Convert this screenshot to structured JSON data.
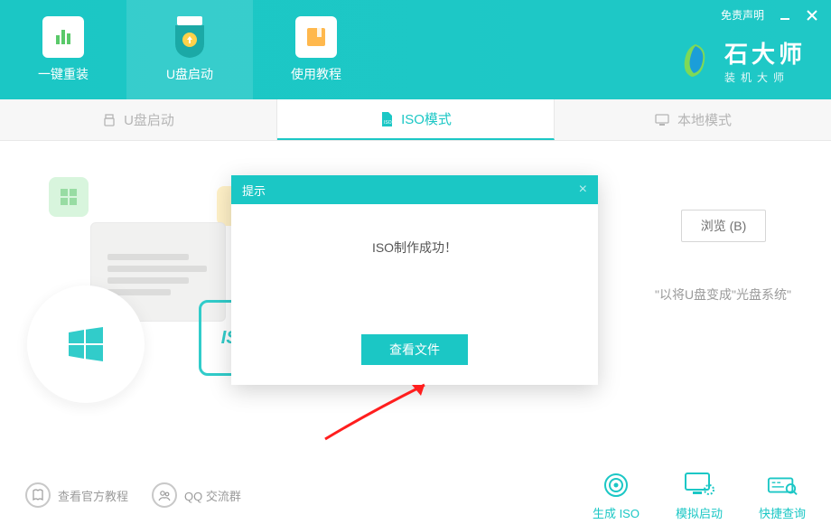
{
  "header": {
    "disclaimer": "免责声明",
    "nav": [
      {
        "label": "一键重装"
      },
      {
        "label": "U盘启动"
      },
      {
        "label": "使用教程"
      }
    ],
    "brand_name": "石大师",
    "brand_sub": "装机大师"
  },
  "tabs": [
    {
      "label": "U盘启动"
    },
    {
      "label": "ISO模式"
    },
    {
      "label": "本地模式"
    }
  ],
  "content": {
    "browse_label": "浏览 (B)",
    "hint": "\"以将U盘变成\"光盘系统\"",
    "iso_badge": "ISO"
  },
  "dialog": {
    "title": "提示",
    "message": "ISO制作成功！",
    "button": "查看文件"
  },
  "footer": {
    "links": [
      {
        "label": "查看官方教程"
      },
      {
        "label": "QQ 交流群"
      }
    ],
    "actions": [
      {
        "label": "生成 ISO"
      },
      {
        "label": "模拟启动"
      },
      {
        "label": "快捷查询"
      }
    ]
  }
}
